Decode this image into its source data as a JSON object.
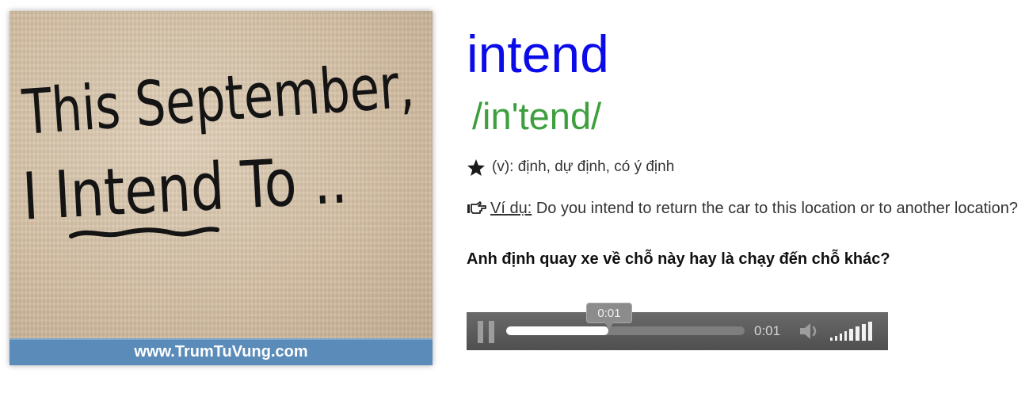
{
  "image_card": {
    "handwriting_line1": "This September,",
    "handwriting_line2": "I Intend To ..",
    "footer_url": "www.TrumTuVung.com",
    "footer_color": "#5a8bb9"
  },
  "entry": {
    "word": "intend",
    "phonetic": "/in'tend/",
    "meaning": "(v): định, dự định, có ý định",
    "meaning_icon": "star-icon",
    "example_icon": "hand-pointing-icon",
    "example_label": "Ví dụ:",
    "example_text": "Do you intend to return the car to this location or to another location?",
    "translation": "Anh định quay xe về chỗ này hay là chạy đến chỗ khác?",
    "word_color": "#0b0bea",
    "phonetic_color": "#3d9f3d"
  },
  "player": {
    "current_time": "0:01",
    "tooltip_time": "0:01",
    "progress_fraction": 0.43,
    "volume_level": 1.0,
    "pause_icon": "pause-icon",
    "volume_icon": "speaker-icon"
  }
}
